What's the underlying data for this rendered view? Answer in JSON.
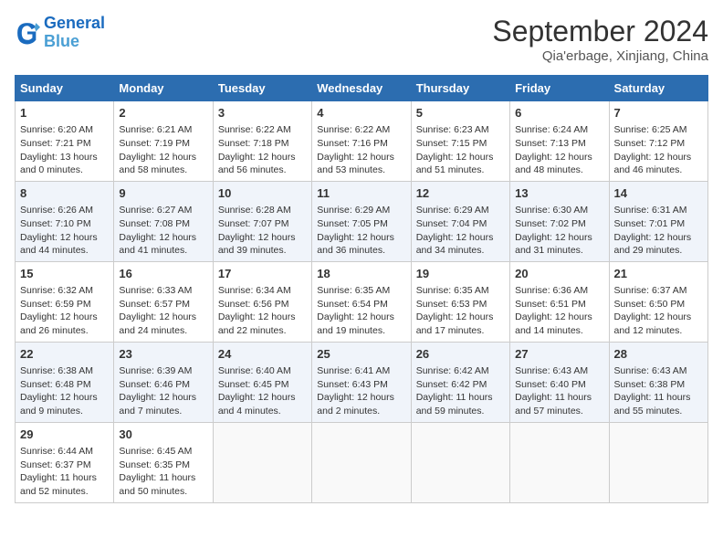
{
  "header": {
    "logo_line1": "General",
    "logo_line2": "Blue",
    "month": "September 2024",
    "location": "Qia'erbage, Xinjiang, China"
  },
  "weekdays": [
    "Sunday",
    "Monday",
    "Tuesday",
    "Wednesday",
    "Thursday",
    "Friday",
    "Saturday"
  ],
  "weeks": [
    [
      {
        "day": "1",
        "lines": [
          "Sunrise: 6:20 AM",
          "Sunset: 7:21 PM",
          "Daylight: 13 hours",
          "and 0 minutes."
        ]
      },
      {
        "day": "2",
        "lines": [
          "Sunrise: 6:21 AM",
          "Sunset: 7:19 PM",
          "Daylight: 12 hours",
          "and 58 minutes."
        ]
      },
      {
        "day": "3",
        "lines": [
          "Sunrise: 6:22 AM",
          "Sunset: 7:18 PM",
          "Daylight: 12 hours",
          "and 56 minutes."
        ]
      },
      {
        "day": "4",
        "lines": [
          "Sunrise: 6:22 AM",
          "Sunset: 7:16 PM",
          "Daylight: 12 hours",
          "and 53 minutes."
        ]
      },
      {
        "day": "5",
        "lines": [
          "Sunrise: 6:23 AM",
          "Sunset: 7:15 PM",
          "Daylight: 12 hours",
          "and 51 minutes."
        ]
      },
      {
        "day": "6",
        "lines": [
          "Sunrise: 6:24 AM",
          "Sunset: 7:13 PM",
          "Daylight: 12 hours",
          "and 48 minutes."
        ]
      },
      {
        "day": "7",
        "lines": [
          "Sunrise: 6:25 AM",
          "Sunset: 7:12 PM",
          "Daylight: 12 hours",
          "and 46 minutes."
        ]
      }
    ],
    [
      {
        "day": "8",
        "lines": [
          "Sunrise: 6:26 AM",
          "Sunset: 7:10 PM",
          "Daylight: 12 hours",
          "and 44 minutes."
        ]
      },
      {
        "day": "9",
        "lines": [
          "Sunrise: 6:27 AM",
          "Sunset: 7:08 PM",
          "Daylight: 12 hours",
          "and 41 minutes."
        ]
      },
      {
        "day": "10",
        "lines": [
          "Sunrise: 6:28 AM",
          "Sunset: 7:07 PM",
          "Daylight: 12 hours",
          "and 39 minutes."
        ]
      },
      {
        "day": "11",
        "lines": [
          "Sunrise: 6:29 AM",
          "Sunset: 7:05 PM",
          "Daylight: 12 hours",
          "and 36 minutes."
        ]
      },
      {
        "day": "12",
        "lines": [
          "Sunrise: 6:29 AM",
          "Sunset: 7:04 PM",
          "Daylight: 12 hours",
          "and 34 minutes."
        ]
      },
      {
        "day": "13",
        "lines": [
          "Sunrise: 6:30 AM",
          "Sunset: 7:02 PM",
          "Daylight: 12 hours",
          "and 31 minutes."
        ]
      },
      {
        "day": "14",
        "lines": [
          "Sunrise: 6:31 AM",
          "Sunset: 7:01 PM",
          "Daylight: 12 hours",
          "and 29 minutes."
        ]
      }
    ],
    [
      {
        "day": "15",
        "lines": [
          "Sunrise: 6:32 AM",
          "Sunset: 6:59 PM",
          "Daylight: 12 hours",
          "and 26 minutes."
        ]
      },
      {
        "day": "16",
        "lines": [
          "Sunrise: 6:33 AM",
          "Sunset: 6:57 PM",
          "Daylight: 12 hours",
          "and 24 minutes."
        ]
      },
      {
        "day": "17",
        "lines": [
          "Sunrise: 6:34 AM",
          "Sunset: 6:56 PM",
          "Daylight: 12 hours",
          "and 22 minutes."
        ]
      },
      {
        "day": "18",
        "lines": [
          "Sunrise: 6:35 AM",
          "Sunset: 6:54 PM",
          "Daylight: 12 hours",
          "and 19 minutes."
        ]
      },
      {
        "day": "19",
        "lines": [
          "Sunrise: 6:35 AM",
          "Sunset: 6:53 PM",
          "Daylight: 12 hours",
          "and 17 minutes."
        ]
      },
      {
        "day": "20",
        "lines": [
          "Sunrise: 6:36 AM",
          "Sunset: 6:51 PM",
          "Daylight: 12 hours",
          "and 14 minutes."
        ]
      },
      {
        "day": "21",
        "lines": [
          "Sunrise: 6:37 AM",
          "Sunset: 6:50 PM",
          "Daylight: 12 hours",
          "and 12 minutes."
        ]
      }
    ],
    [
      {
        "day": "22",
        "lines": [
          "Sunrise: 6:38 AM",
          "Sunset: 6:48 PM",
          "Daylight: 12 hours",
          "and 9 minutes."
        ]
      },
      {
        "day": "23",
        "lines": [
          "Sunrise: 6:39 AM",
          "Sunset: 6:46 PM",
          "Daylight: 12 hours",
          "and 7 minutes."
        ]
      },
      {
        "day": "24",
        "lines": [
          "Sunrise: 6:40 AM",
          "Sunset: 6:45 PM",
          "Daylight: 12 hours",
          "and 4 minutes."
        ]
      },
      {
        "day": "25",
        "lines": [
          "Sunrise: 6:41 AM",
          "Sunset: 6:43 PM",
          "Daylight: 12 hours",
          "and 2 minutes."
        ]
      },
      {
        "day": "26",
        "lines": [
          "Sunrise: 6:42 AM",
          "Sunset: 6:42 PM",
          "Daylight: 11 hours",
          "and 59 minutes."
        ]
      },
      {
        "day": "27",
        "lines": [
          "Sunrise: 6:43 AM",
          "Sunset: 6:40 PM",
          "Daylight: 11 hours",
          "and 57 minutes."
        ]
      },
      {
        "day": "28",
        "lines": [
          "Sunrise: 6:43 AM",
          "Sunset: 6:38 PM",
          "Daylight: 11 hours",
          "and 55 minutes."
        ]
      }
    ],
    [
      {
        "day": "29",
        "lines": [
          "Sunrise: 6:44 AM",
          "Sunset: 6:37 PM",
          "Daylight: 11 hours",
          "and 52 minutes."
        ]
      },
      {
        "day": "30",
        "lines": [
          "Sunrise: 6:45 AM",
          "Sunset: 6:35 PM",
          "Daylight: 11 hours",
          "and 50 minutes."
        ]
      },
      {
        "day": "",
        "lines": []
      },
      {
        "day": "",
        "lines": []
      },
      {
        "day": "",
        "lines": []
      },
      {
        "day": "",
        "lines": []
      },
      {
        "day": "",
        "lines": []
      }
    ]
  ]
}
